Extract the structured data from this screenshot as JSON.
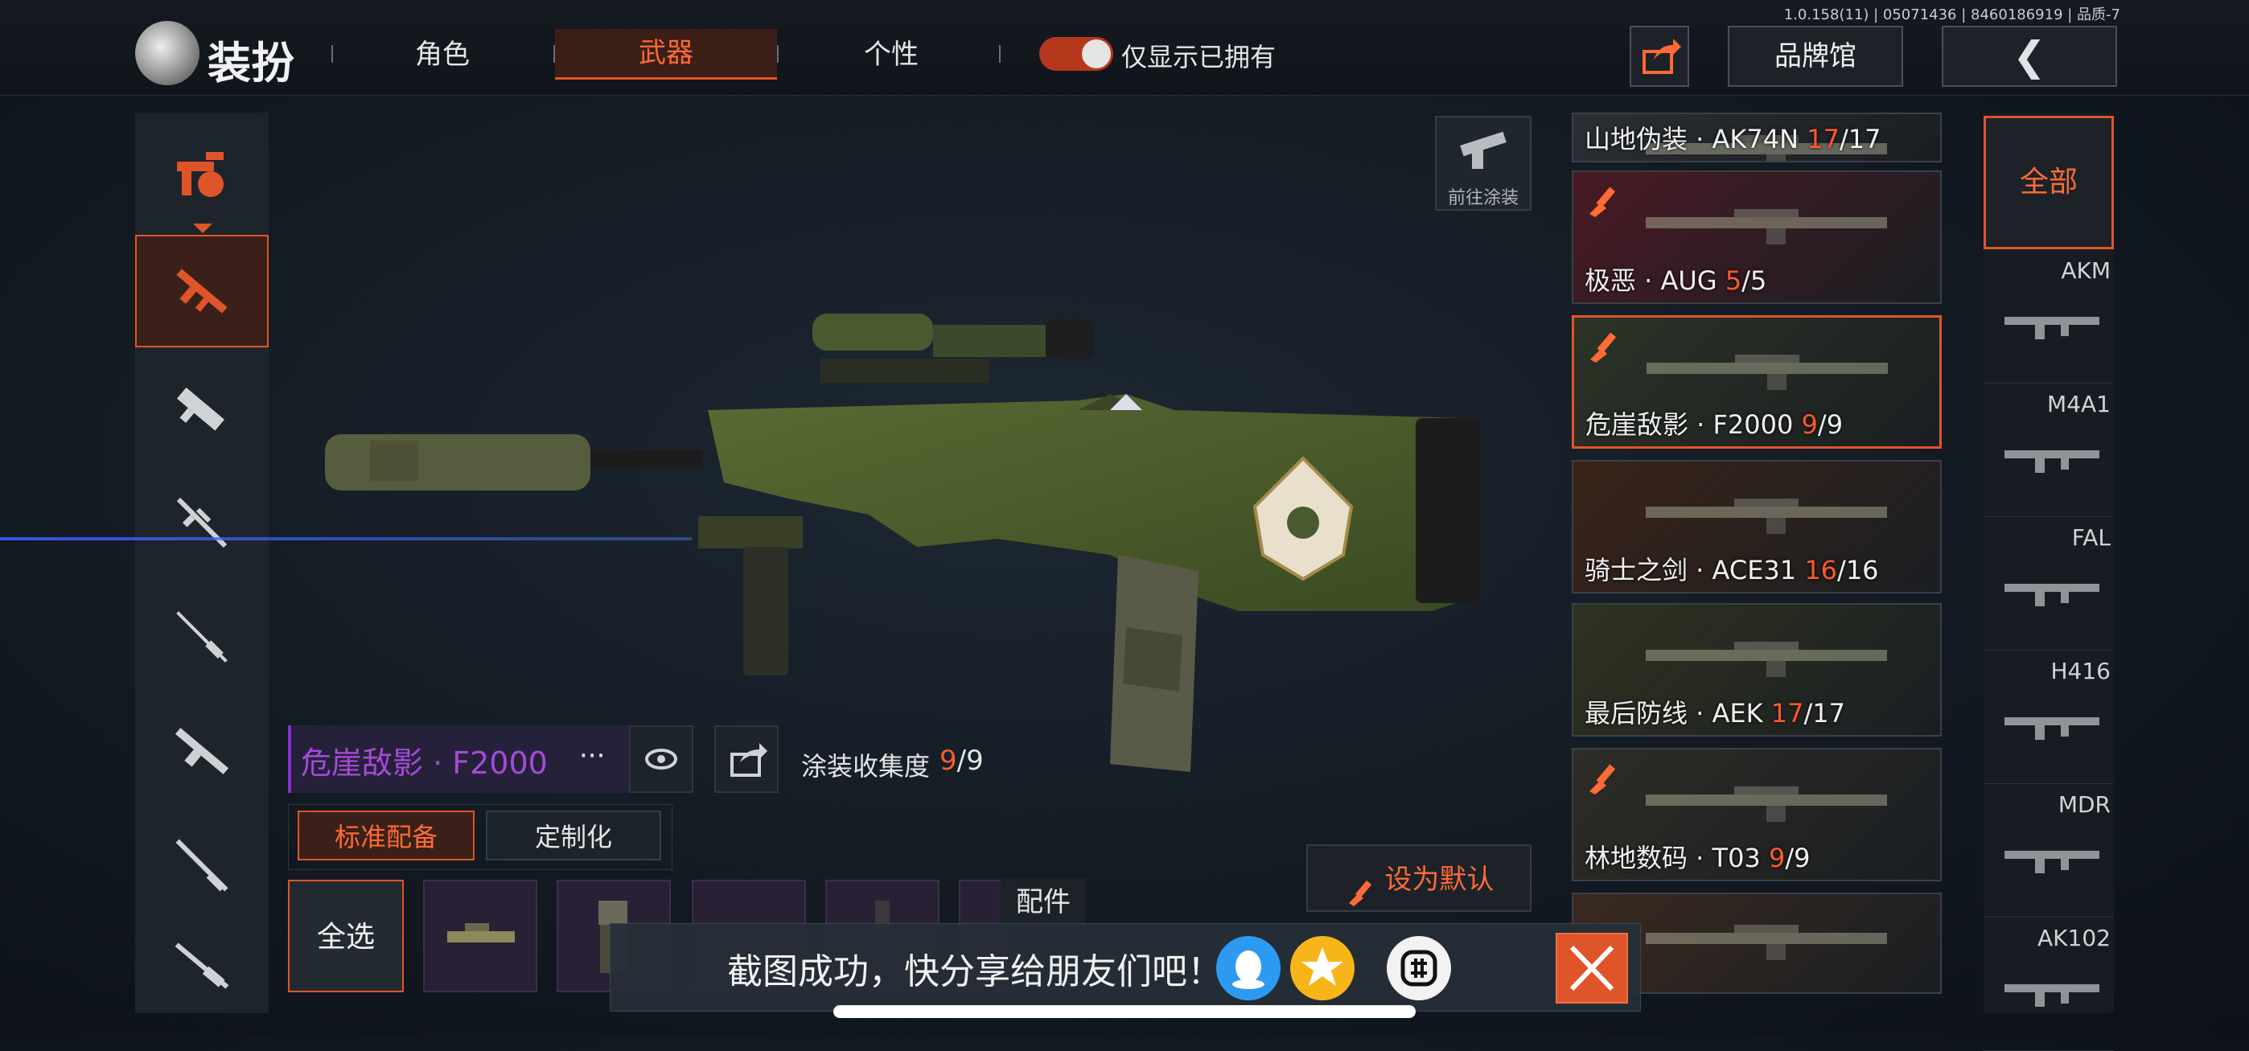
{
  "version_text": "1.0.158(11) | 05071436 | 8460186919 | 品质-7",
  "header": {
    "title": "装扮",
    "tabs": [
      {
        "label": "角色",
        "active": false
      },
      {
        "label": "武器",
        "active": true
      },
      {
        "label": "个性",
        "active": false
      }
    ],
    "toggle_label": "仅显示已拥有",
    "toggle_on": true,
    "brand_label": "品牌馆",
    "back_symbol": "❮"
  },
  "sidebar": {
    "items": [
      {
        "name": "all-weapons-icon",
        "active": false
      },
      {
        "name": "assault-rifle-icon",
        "active": true
      },
      {
        "name": "smg-icon",
        "active": false
      },
      {
        "name": "sniper-icon",
        "active": false
      },
      {
        "name": "marksman-rifle-icon",
        "active": false
      },
      {
        "name": "lmg-icon",
        "active": false
      },
      {
        "name": "shotgun-icon",
        "active": false
      },
      {
        "name": "rifle-icon",
        "active": false
      }
    ]
  },
  "weapon": {
    "skin_name": "危崖敌影 · F2000",
    "more": "···",
    "collection_label": "涂装收集度",
    "collection_owned": "9",
    "collection_total": "/9",
    "loadout_tabs": {
      "standard": "标准配备",
      "custom": "定制化"
    },
    "select_all": "全选",
    "attachments_label": "配件",
    "set_default": "设为默认",
    "goto_paint": "前往涂装"
  },
  "skins": [
    {
      "name": "山地伪装 · AK74N ",
      "owned": "17",
      "total": "/17",
      "selected": false,
      "brush": false,
      "bg": "#2a2f34"
    },
    {
      "name": "极恶 · AUG ",
      "owned": "5",
      "total": "/5",
      "selected": false,
      "brush": true,
      "bg": "#4a1a24"
    },
    {
      "name": "危崖敌影 · F2000 ",
      "owned": "9",
      "total": "/9",
      "selected": true,
      "brush": true,
      "bg": "#2c3326"
    },
    {
      "name": "骑士之剑 · ACE31 ",
      "owned": "16",
      "total": "/16",
      "selected": false,
      "brush": false,
      "bg": "#3a2418"
    },
    {
      "name": "最后防线 · AEK ",
      "owned": "17",
      "total": "/17",
      "selected": false,
      "brush": false,
      "bg": "#2f3320"
    },
    {
      "name": "林地数码 · T03 ",
      "owned": "9",
      "total": "/9",
      "selected": false,
      "brush": true,
      "bg": "#2e2c26"
    },
    {
      "name": "",
      "owned": "",
      "total": "",
      "selected": false,
      "brush": false,
      "bg": "#3a2a20"
    }
  ],
  "weapon_list": {
    "all_label": "全部",
    "items": [
      "AKM",
      "M4A1",
      "FAL",
      "H416",
      "MDR",
      "AK102"
    ]
  },
  "toast": {
    "message": "截图成功，快分享给朋友们吧！",
    "share_targets": [
      "qq-icon",
      "qzone-icon",
      "share-other-icon"
    ]
  },
  "colors": {
    "accent": "#e0542a",
    "purple": "#a64ad8",
    "highlight": "#ff5a2a"
  }
}
